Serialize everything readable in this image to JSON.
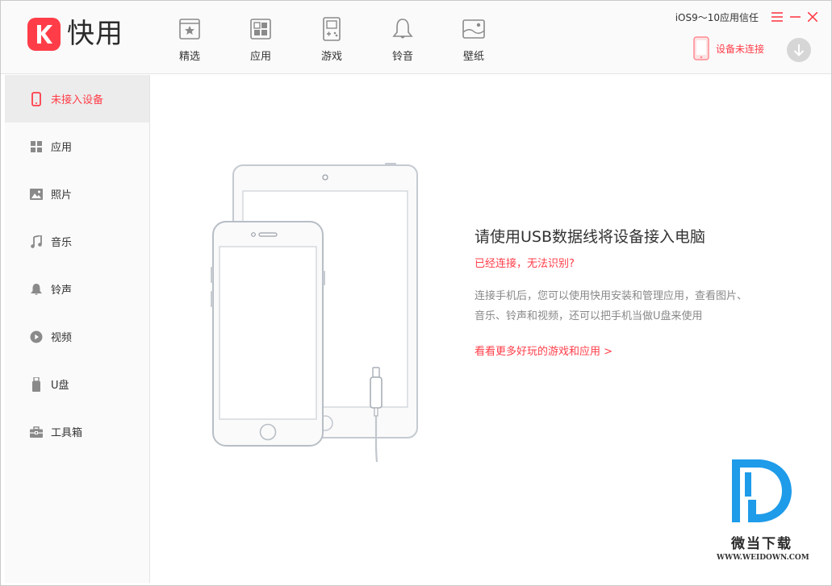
{
  "app": {
    "name": "快用",
    "trust_link": "iOS9～10应用信任",
    "device_status": "设备未连接"
  },
  "nav": [
    {
      "label": "精选",
      "icon": "star-icon"
    },
    {
      "label": "应用",
      "icon": "apps-grid-icon"
    },
    {
      "label": "游戏",
      "icon": "gameboy-icon"
    },
    {
      "label": "铃音",
      "icon": "bell-icon"
    },
    {
      "label": "壁纸",
      "icon": "picture-icon"
    }
  ],
  "sidebar": {
    "items": [
      {
        "label": "未接入设备",
        "icon": "phone-icon",
        "active": true
      },
      {
        "label": "应用",
        "icon": "grid-icon"
      },
      {
        "label": "照片",
        "icon": "photo-icon"
      },
      {
        "label": "音乐",
        "icon": "music-note-icon"
      },
      {
        "label": "铃声",
        "icon": "bell-icon"
      },
      {
        "label": "视频",
        "icon": "play-icon"
      },
      {
        "label": "U盘",
        "icon": "usb-drive-icon"
      },
      {
        "label": "工具箱",
        "icon": "toolbox-icon"
      }
    ]
  },
  "main": {
    "title": "请使用USB数据线将设备接入电脑",
    "error_link": "已经连接，无法识别?",
    "description_line1": "连接手机后，您可以使用快用安装和管理应用，查看图片、",
    "description_line2": "音乐、铃声和视频，还可以把手机当做U盘来使用",
    "more_link": "看看更多好玩的游戏和应用 >"
  },
  "watermark": {
    "name": "微当下载",
    "url": "WWW.WEIDOWN.COM"
  },
  "colors": {
    "accent": "#ff3d48",
    "sidebar_bg": "#fafafa",
    "active_bg": "#ececec",
    "icon_gray": "#8a8a8a",
    "watermark_blue": "#1e9be9"
  }
}
